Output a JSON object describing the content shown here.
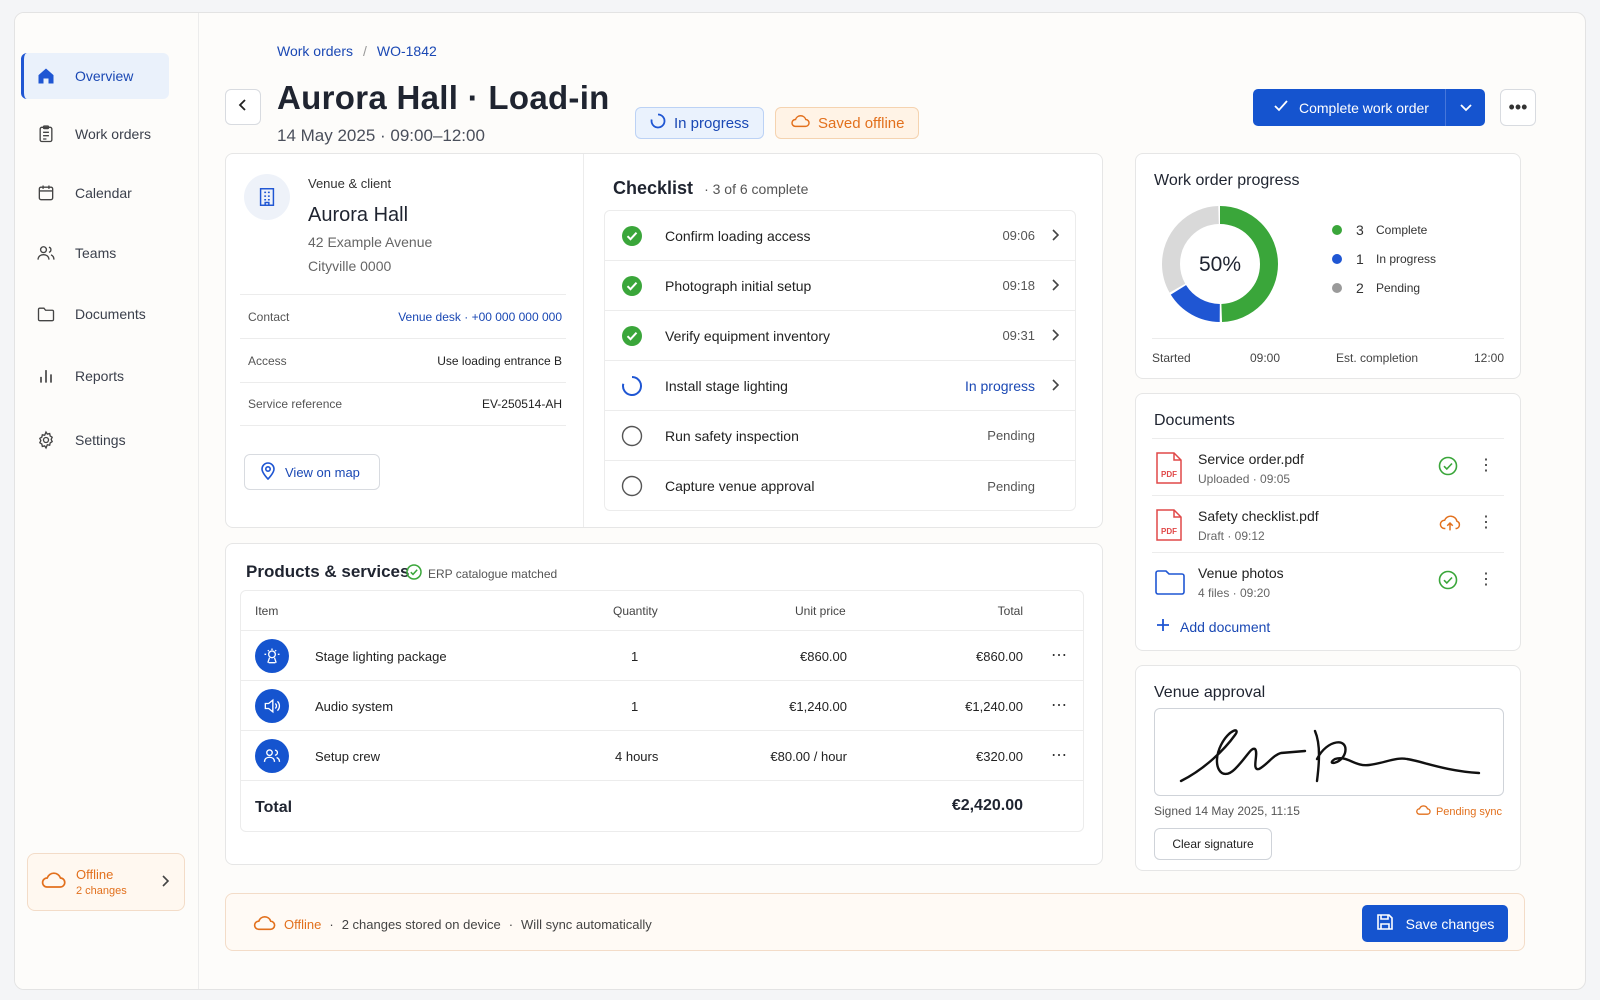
{
  "colors": {
    "accent": "#1554cf",
    "link": "#1a48b4",
    "complete": "#3aa63a",
    "in_progress": "#1f56d3",
    "pending": "#9a9a9a",
    "offline": "#e2701d"
  },
  "sidebar": {
    "items": [
      {
        "label": "Overview",
        "icon": "home-icon",
        "active": true
      },
      {
        "label": "Work orders",
        "icon": "clipboard-icon"
      },
      {
        "label": "Calendar",
        "icon": "calendar-icon"
      },
      {
        "label": "Teams",
        "icon": "users-icon"
      },
      {
        "label": "Documents",
        "icon": "folder-icon"
      },
      {
        "label": "Reports",
        "icon": "bar-chart-icon"
      },
      {
        "label": "Settings",
        "icon": "gear-icon"
      }
    ],
    "offline": {
      "title": "Offline",
      "changes": "2 changes"
    }
  },
  "breadcrumb": {
    "parent": "Work orders",
    "current": "WO-1842"
  },
  "header": {
    "title": "Aurora Hall · Load-in",
    "subtitle": "14 May 2025 · 09:00–12:00",
    "status": "In progress",
    "offline_status": "Saved offline",
    "complete_button": "Complete work order"
  },
  "venue": {
    "label": "Venue & client",
    "name": "Aurora Hall",
    "address_line1": "42 Example Avenue",
    "address_line2": "Cityville 0000",
    "contact_label": "Contact",
    "contact_value": "Venue desk · +00 000 000 000",
    "access_label": "Access",
    "access_value": "Use loading entrance B",
    "ref_label": "Service reference",
    "ref_value": "EV-250514-AH",
    "map_button": "View on map"
  },
  "checklist": {
    "title": "Checklist",
    "summary": "3 of 6 complete",
    "items": [
      {
        "label": "Confirm loading access",
        "status": "complete",
        "value": "09:06"
      },
      {
        "label": "Photograph initial setup",
        "status": "complete",
        "value": "09:18"
      },
      {
        "label": "Verify equipment inventory",
        "status": "complete",
        "value": "09:31"
      },
      {
        "label": "Install stage lighting",
        "status": "in_progress",
        "value": "In progress"
      },
      {
        "label": "Run safety inspection",
        "status": "pending",
        "value": "Pending"
      },
      {
        "label": "Capture venue approval",
        "status": "pending",
        "value": "Pending"
      }
    ]
  },
  "products": {
    "title": "Products & services",
    "badge": "ERP catalogue matched",
    "columns": {
      "item": "Item",
      "quantity": "Quantity",
      "unit_price": "Unit price",
      "total": "Total"
    },
    "rows": [
      {
        "item": "Stage lighting package",
        "quantity": "1",
        "unit_price": "€860.00",
        "total": "€860.00",
        "icon": "lighting-icon"
      },
      {
        "item": "Audio system",
        "quantity": "1",
        "unit_price": "€1,240.00",
        "total": "€1,240.00",
        "icon": "speaker-icon"
      },
      {
        "item": "Setup crew",
        "quantity": "4 hours",
        "unit_price": "€80.00 / hour",
        "total": "€320.00",
        "icon": "users-icon"
      }
    ],
    "total_label": "Total",
    "total_value": "€2,420.00"
  },
  "progress": {
    "title": "Work order progress",
    "percent_label": "50%",
    "complete": 3,
    "in_progress": 1,
    "pending": 2,
    "complete_label": "Complete",
    "in_progress_label": "In progress",
    "pending_label": "Pending",
    "complete_count": "3",
    "in_progress_count": "1",
    "pending_count": "2",
    "started_label": "Started",
    "started_value": "09:00",
    "est_label": "Est. completion",
    "est_value": "12:00"
  },
  "documents": {
    "title": "Documents",
    "items": [
      {
        "name": "Service order.pdf",
        "meta": "Uploaded · 09:05",
        "type": "pdf",
        "status": "uploaded"
      },
      {
        "name": "Safety checklist.pdf",
        "meta": "Draft · 09:12",
        "type": "pdf",
        "status": "pending-upload"
      },
      {
        "name": "Venue photos",
        "meta": "4 files · 09:20",
        "type": "folder",
        "status": "uploaded"
      }
    ],
    "add_label": "Add document"
  },
  "approval": {
    "title": "Venue approval",
    "signed": "Signed 14 May 2025, 11:15",
    "pending_sync": "Pending sync",
    "clear_button": "Clear signature"
  },
  "bottom_bar": {
    "offline": "Offline",
    "stored": "2 changes stored on device",
    "sync": "Will sync automatically",
    "save_button": "Save changes"
  }
}
